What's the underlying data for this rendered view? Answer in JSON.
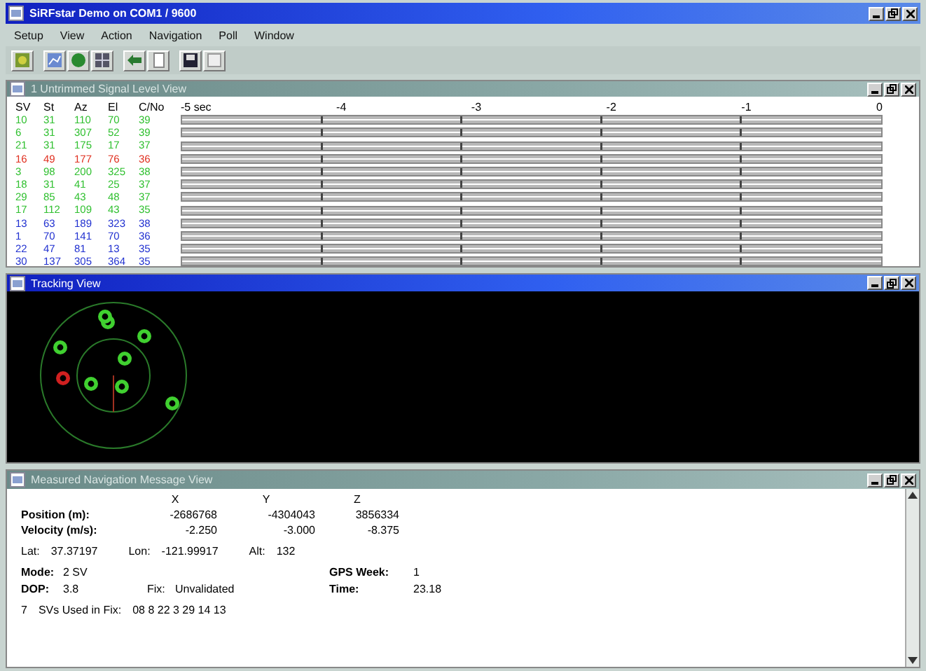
{
  "window": {
    "title": "SiRFstar Demo on COM1 / 9600"
  },
  "menu": [
    "Setup",
    "View",
    "Action",
    "Navigation",
    "Poll",
    "Window"
  ],
  "signal_view": {
    "title": "1 Untrimmed Signal Level View",
    "columns": [
      "SV",
      "St",
      "Az",
      "El",
      "C/No"
    ],
    "scale": [
      "-5 sec",
      "-4",
      "-3",
      "-2",
      "-1",
      "0"
    ],
    "rows": [
      {
        "cells": [
          "10",
          "31",
          "110",
          "70",
          "39"
        ],
        "color": "#30c030"
      },
      {
        "cells": [
          "6",
          "31",
          "307",
          "52",
          "39"
        ],
        "color": "#30c030"
      },
      {
        "cells": [
          "21",
          "31",
          "175",
          "17",
          "37"
        ],
        "color": "#30c030"
      },
      {
        "cells": [
          "16",
          "49",
          "177",
          "76",
          "36"
        ],
        "color": "#e03020"
      },
      {
        "cells": [
          "3",
          "98",
          "200",
          "325",
          "38"
        ],
        "color": "#30c030"
      },
      {
        "cells": [
          "18",
          "31",
          "41",
          "25",
          "37"
        ],
        "color": "#30c030"
      },
      {
        "cells": [
          "29",
          "85",
          "43",
          "48",
          "37"
        ],
        "color": "#30c030"
      },
      {
        "cells": [
          "17",
          "112",
          "109",
          "43",
          "35"
        ],
        "color": "#30c030"
      },
      {
        "cells": [
          "13",
          "63",
          "189",
          "323",
          "38"
        ],
        "color": "#2030d0"
      },
      {
        "cells": [
          "1",
          "70",
          "141",
          "70",
          "36"
        ],
        "color": "#2030d0"
      },
      {
        "cells": [
          "22",
          "47",
          "81",
          "13",
          "35"
        ],
        "color": "#2030d0"
      },
      {
        "cells": [
          "30",
          "137",
          "305",
          "364",
          "35"
        ],
        "color": "#2030d0"
      }
    ]
  },
  "tracking_view": {
    "title": "Tracking View"
  },
  "nav_view": {
    "title": "Measured Navigation Message View",
    "axes": [
      "X",
      "Y",
      "Z"
    ],
    "measurements": [
      {
        "label": "Position (m):",
        "values": [
          "-2686768",
          "-4304043",
          "3856334"
        ]
      },
      {
        "label": "Velocity (m/s):",
        "values": [
          "-2.250",
          "-3.000",
          "-8.375"
        ]
      }
    ],
    "lat": {
      "label": "Lat:",
      "value": "37.37197"
    },
    "lon": {
      "label": "Lon:",
      "value": "-121.99917"
    },
    "alt": {
      "label": "Alt:",
      "value": "132"
    },
    "mode": {
      "label": "Mode:",
      "value": "2 SV"
    },
    "gps_week": {
      "label": "GPS Week:",
      "value": "1"
    },
    "dop": {
      "label": "DOP:",
      "value": "3.8"
    },
    "fix": {
      "label": "Fix:",
      "value": "Unvalidated"
    },
    "time": {
      "label": "Time:",
      "value": "23.18"
    },
    "svs_count": "7",
    "svs": {
      "label": "SVs Used in Fix:",
      "value": "08 8 22 3 29 14 13"
    }
  }
}
